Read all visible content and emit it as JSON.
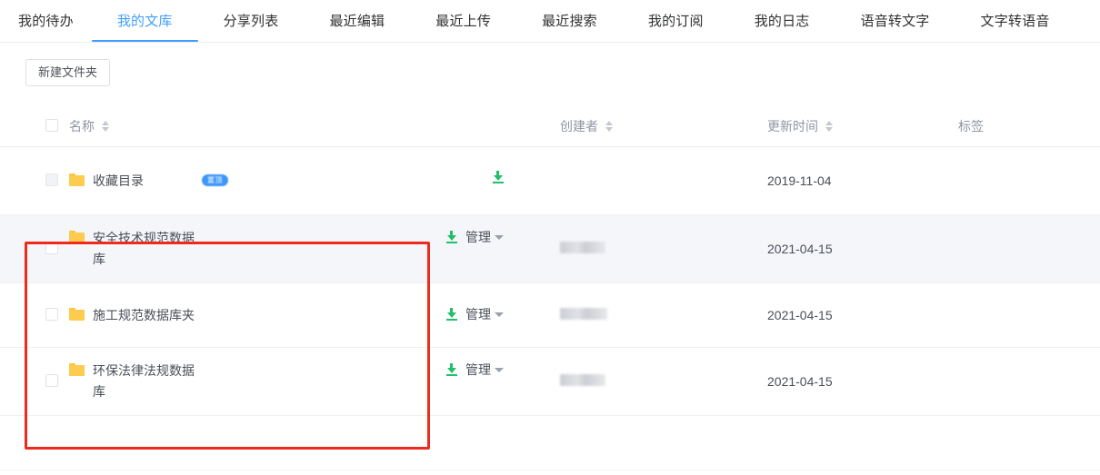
{
  "tabs": [
    {
      "label": "我的待办",
      "active": false
    },
    {
      "label": "我的文库",
      "active": true
    },
    {
      "label": "分享列表",
      "active": false
    },
    {
      "label": "最近编辑",
      "active": false
    },
    {
      "label": "最近上传",
      "active": false
    },
    {
      "label": "最近搜索",
      "active": false
    },
    {
      "label": "我的订阅",
      "active": false
    },
    {
      "label": "我的日志",
      "active": false
    },
    {
      "label": "语音转文字",
      "active": false
    },
    {
      "label": "文字转语音",
      "active": false
    }
  ],
  "toolbar": {
    "new_folder_label": "新建文件夹"
  },
  "table": {
    "headers": {
      "name": "名称",
      "creator": "创建者",
      "updated": "更新时间",
      "tag": "标签"
    },
    "rows": [
      {
        "name": "收藏目录",
        "badge": "置顶",
        "has_download": true,
        "manage_label": "",
        "creator": "",
        "updated": "2019-11-04",
        "tag": ""
      },
      {
        "name": "安全技术规范数据库",
        "badge": "",
        "has_download": true,
        "manage_label": "管理",
        "creator": "",
        "updated": "2021-04-15",
        "tag": ""
      },
      {
        "name": "施工规范数据库夹",
        "badge": "",
        "has_download": true,
        "manage_label": "管理",
        "creator": "",
        "updated": "2021-04-15",
        "tag": ""
      },
      {
        "name": "环保法律法规数据库",
        "badge": "",
        "has_download": true,
        "manage_label": "管理",
        "creator": "",
        "updated": "2021-04-15",
        "tag": ""
      }
    ]
  },
  "colors": {
    "accent": "#409eff",
    "folder": "#fdcb4e",
    "download": "#22bf6a",
    "badge": "#3d97f7",
    "annotation": "#ee2a1c",
    "row_highlight": "#f5f6fa"
  }
}
